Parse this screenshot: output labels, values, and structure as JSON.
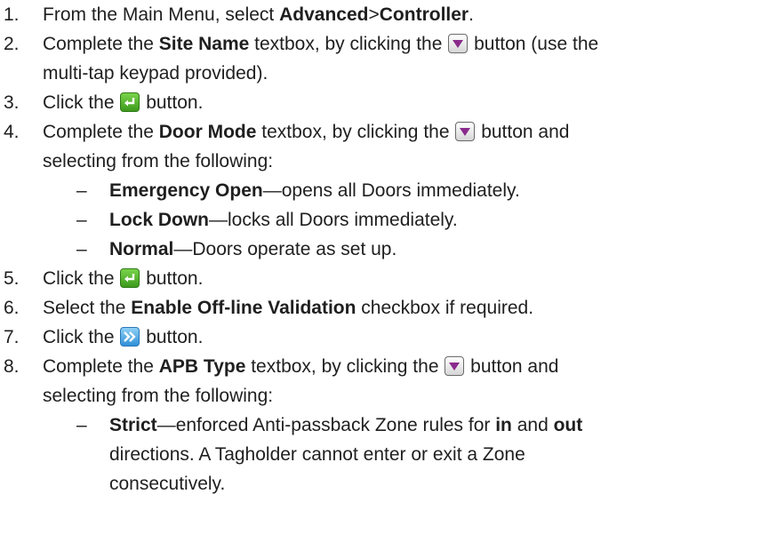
{
  "steps": [
    {
      "num": "1.",
      "parts": [
        "From the Main Menu, select ",
        "Advanced",
        ">",
        "Controller",
        "."
      ]
    },
    {
      "num": "2.",
      "parts": [
        "Complete the ",
        "Site Name",
        " textbox, by clicking the ",
        " button (use the"
      ],
      "cont": "multi-tap keypad provided)."
    },
    {
      "num": "3.",
      "parts": [
        "Click the ",
        " button."
      ]
    },
    {
      "num": "4.",
      "parts": [
        "Complete the ",
        "Door Mode",
        " textbox, by clicking the ",
        " button and"
      ],
      "cont": "selecting from the following:",
      "options": [
        {
          "label": "Emergency Open",
          "desc": "—opens all Doors immediately."
        },
        {
          "label": "Lock Down",
          "desc": "—locks all Doors immediately."
        },
        {
          "label": "Normal",
          "desc": "—Doors operate as set up."
        }
      ]
    },
    {
      "num": "5.",
      "parts": [
        "Click the ",
        " button."
      ]
    },
    {
      "num": "6.",
      "parts": [
        "Select the ",
        "Enable Off-line Validation",
        " checkbox if required."
      ]
    },
    {
      "num": "7.",
      "parts": [
        "Click the ",
        " button."
      ]
    },
    {
      "num": "8.",
      "parts": [
        "Complete the ",
        "APB Type",
        " textbox, by clicking the ",
        " button and"
      ],
      "cont": "selecting from the following:",
      "options": [
        {
          "label": "Strict",
          "desc1": "—enforced Anti-passback Zone rules for ",
          "bold1": "in",
          "mid": " and ",
          "bold2": "out",
          "line2": "directions.  A Tagholder cannot enter or exit a Zone",
          "line3": "consecutively."
        }
      ]
    }
  ],
  "dash": "–",
  "icons": {
    "dropdown": "dropdown-arrow-icon",
    "enter": "enter-return-icon",
    "next": "next-page-icon"
  }
}
